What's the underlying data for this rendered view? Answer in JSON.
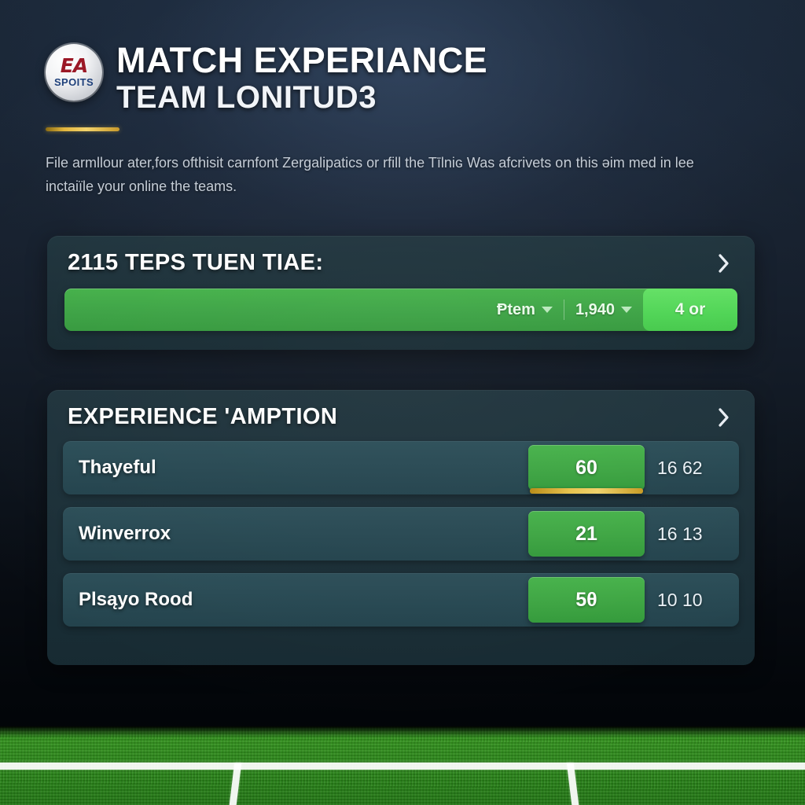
{
  "brand": {
    "logo_icon": "ea-sports-badge-icon",
    "logo_primary": "EA",
    "logo_secondary": "SPOITS"
  },
  "header": {
    "title": "MATCH EXPERIANCE",
    "subtitle": "TEAM LONITUD3",
    "accent_color": "#e2b53c"
  },
  "intro": {
    "text": "File аrmllour ater,fors ofthisit carnfont Zerɡalipatics or rfill the Tīlniɢ Was afcrivets oո this ǝim med in lee inctaiïle your online the teams."
  },
  "progress_card": {
    "title": "2115 TEPS TUEN TIAE:",
    "expand_icon": "chevron-right-icon",
    "bar": {
      "fill_color": "#3da345",
      "dropdown_1": {
        "label": "Ᵽtem",
        "caret_icon": "caret-down-icon"
      },
      "dropdown_2": {
        "label": "1,940",
        "caret_icon": "caret-down-icon"
      },
      "chip": {
        "label": "4 or",
        "color": "#4fd455"
      }
    }
  },
  "list_card": {
    "title": "EXPERIENCE 'AMPTION",
    "expand_icon": "chevron-right-icon",
    "rows": [
      {
        "name": "Thayeful",
        "badge": "60",
        "values": "16 62",
        "highlight": true,
        "badge_color": "#3ea543"
      },
      {
        "name": "Winverrox",
        "badge": "21",
        "values": "16 13",
        "highlight": false,
        "badge_color": "#3ea543"
      },
      {
        "name": "Plsąyo Rood",
        "badge": "5θ",
        "values": "10 10",
        "highlight": false,
        "badge_color": "#3ea543"
      }
    ]
  },
  "pitch": {
    "grass_color": "#2e8c1c",
    "line_color": "#ffffff"
  }
}
